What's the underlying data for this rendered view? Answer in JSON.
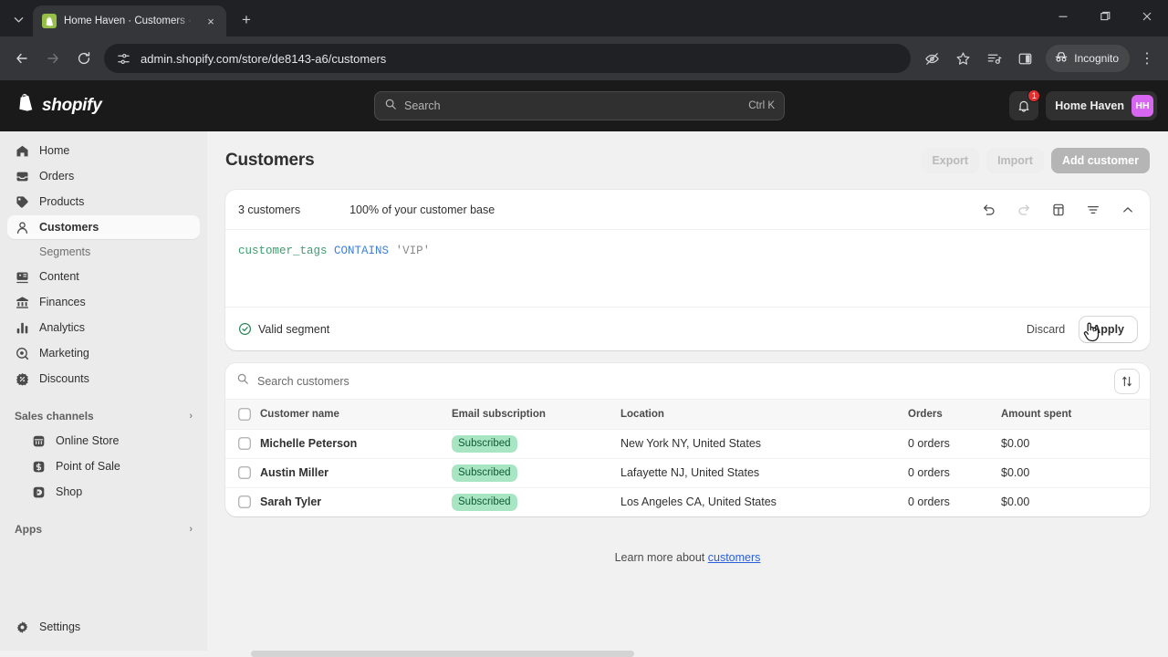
{
  "browser": {
    "tab": {
      "title": "Home Haven · Customers · Sho",
      "favicon": "shopify-bag-icon",
      "close": "×"
    },
    "newtab_label": "+",
    "window": {
      "minimize": "—",
      "maximize": "❐",
      "close": "✕"
    },
    "toolbar": {
      "back": "←",
      "forward": "→",
      "reload": "⟳",
      "url": "admin.shopify.com/store/de8143-a6/customers",
      "site_info_icon": "page-settings-icon",
      "icons": [
        "hide-password-icon",
        "bookmark-star-icon",
        "reading-list-icon",
        "side-panel-icon"
      ],
      "incognito_label": "Incognito",
      "menu": "⋮"
    }
  },
  "topbar": {
    "logo_text": "shopify",
    "search": {
      "placeholder": "Search",
      "shortcut": "Ctrl K"
    },
    "notifications_count": "1",
    "store_name": "Home Haven",
    "store_initials": "HH"
  },
  "sidebar": {
    "items": [
      {
        "label": "Home",
        "icon": "home-icon"
      },
      {
        "label": "Orders",
        "icon": "orders-inbox-icon"
      },
      {
        "label": "Products",
        "icon": "product-tag-icon"
      },
      {
        "label": "Customers",
        "icon": "person-icon",
        "active": true
      },
      {
        "label": "Content",
        "icon": "content-icon"
      },
      {
        "label": "Finances",
        "icon": "bank-icon"
      },
      {
        "label": "Analytics",
        "icon": "bar-chart-icon"
      },
      {
        "label": "Marketing",
        "icon": "megaphone-target-icon"
      },
      {
        "label": "Discounts",
        "icon": "discount-badge-icon"
      }
    ],
    "sub_item": "Segments",
    "sections": [
      {
        "label": "Sales channels",
        "chevron": "›",
        "items": [
          {
            "label": "Online Store",
            "icon": "storefront-icon"
          },
          {
            "label": "Point of Sale",
            "icon": "pos-icon"
          },
          {
            "label": "Shop",
            "icon": "shop-icon"
          }
        ]
      },
      {
        "label": "Apps",
        "chevron": "›",
        "items": []
      }
    ],
    "settings": {
      "label": "Settings",
      "icon": "gear-icon"
    }
  },
  "page": {
    "title": "Customers",
    "actions": {
      "export": "Export",
      "import": "Import",
      "add_customer": "Add customer"
    }
  },
  "segment": {
    "count_label": "3 customers",
    "percent_label": "100% of your customer base",
    "tools": [
      {
        "name": "undo-icon",
        "glyph": "↺",
        "disabled": false
      },
      {
        "name": "redo-icon",
        "glyph": "↻",
        "disabled": true
      },
      {
        "name": "template-panel-icon",
        "glyph": "▤",
        "disabled": false
      },
      {
        "name": "filter-icon",
        "glyph": "≡",
        "disabled": false
      },
      {
        "name": "chevron-up-icon",
        "glyph": "⌃",
        "disabled": false
      }
    ],
    "query": {
      "field": "customer_tags",
      "operator": "CONTAINS",
      "value": "'VIP'"
    },
    "status_text": "Valid segment",
    "discard_label": "Discard",
    "apply_label": "Apply"
  },
  "table": {
    "search_placeholder": "Search customers",
    "sort_icon": "sort-arrows-icon",
    "columns": [
      "Customer name",
      "Email subscription",
      "Location",
      "Orders",
      "Amount spent"
    ],
    "rows": [
      {
        "name": "Michelle Peterson",
        "email_subscription": "Subscribed",
        "location": "New York NY, United States",
        "orders": "0 orders",
        "amount_spent": "$0.00"
      },
      {
        "name": "Austin Miller",
        "email_subscription": "Subscribed",
        "location": "Lafayette NJ, United States",
        "orders": "0 orders",
        "amount_spent": "$0.00"
      },
      {
        "name": "Sarah Tyler",
        "email_subscription": "Subscribed",
        "location": "Los Angeles CA, United States",
        "orders": "0 orders",
        "amount_spent": "$0.00"
      }
    ]
  },
  "footer": {
    "learn_more_prefix": "Learn more about ",
    "learn_more_link": "customers"
  },
  "colors": {
    "shopify_dark": "#1a1a1a",
    "avatar": "#d767f0",
    "badge_bg": "#a8e5c3",
    "badge_text": "#0f5c38",
    "link": "#2b5fd9",
    "token_field": "#3a9e6e",
    "token_operator": "#3d7fd6",
    "token_string": "#8a8a8a"
  }
}
